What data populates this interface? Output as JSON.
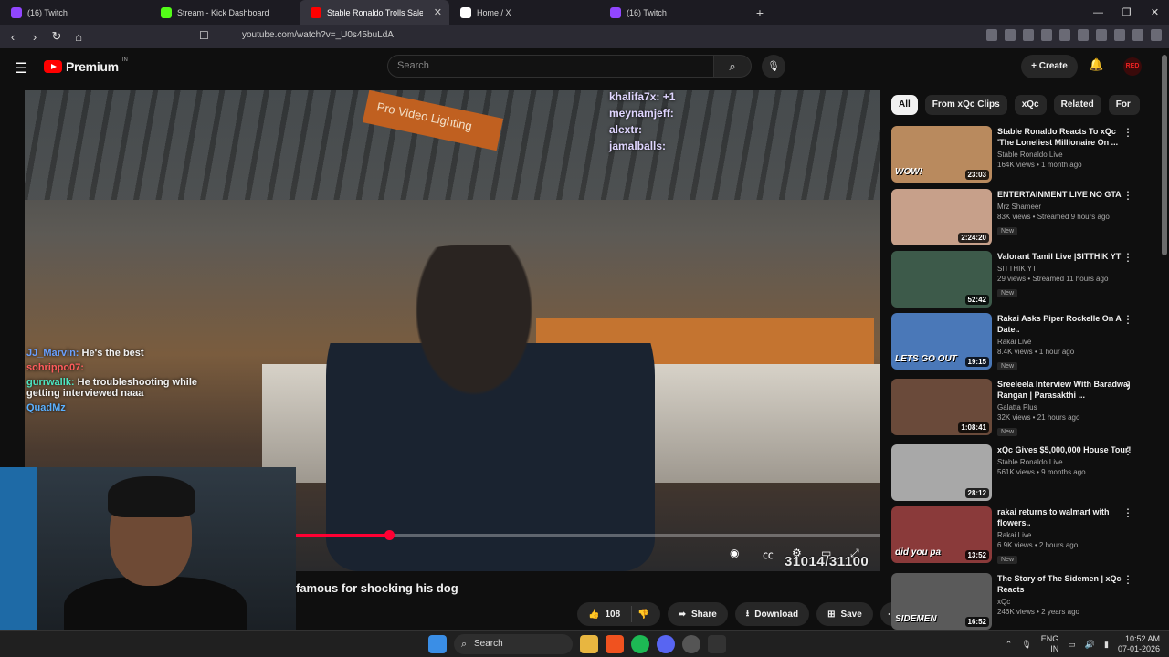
{
  "tabs": [
    {
      "label": "(16) Twitch",
      "color": "#9146ff"
    },
    {
      "label": "Stream - Kick Dashboard",
      "color": "#53fc18"
    },
    {
      "label": "Stable Ronaldo Trolls Salesma",
      "color": "#ff0000"
    },
    {
      "label": "Home / X",
      "color": "#ffffff"
    },
    {
      "label": "(16) Twitch",
      "color": "#9146ff"
    }
  ],
  "browser": {
    "url": "youtube.com/watch?v=_U0s45buLdA",
    "new_tab": "+"
  },
  "header": {
    "brand": "Premium",
    "region": "IN",
    "search_placeholder": "Search",
    "create_label": "Create",
    "avatar_text": "RED"
  },
  "player": {
    "banner_text": "Pro Video Lighting",
    "chat_top": [
      "khalifa7x: +1",
      "meynamjeff:",
      "alextr:",
      "jamalballs:"
    ],
    "overlay_chat": [
      {
        "user": "JJ_Marvin:",
        "msg": "He's the best"
      },
      {
        "user": "sohrippo07:",
        "msg": ""
      },
      {
        "user": "gurrwallk:",
        "msg": "He troubleshooting while getting interviewed naaa"
      },
      {
        "user": "QuadMz",
        "msg": ""
      }
    ],
    "counter": "31014/31100",
    "progress": 0.16
  },
  "video": {
    "title": "famous for shocking his dog",
    "likes": "108",
    "share_label": "Share",
    "download_label": "Download",
    "save_label": "Save"
  },
  "chips": [
    "All",
    "From xQc Clips",
    "xQc",
    "Related",
    "For"
  ],
  "recommendations": [
    {
      "title": "Stable Ronaldo Reacts To xQc 'The Loneliest Millionaire On ...",
      "channel": "Stable Ronaldo Live",
      "stats": "164K views • 1 month ago",
      "duration": "23:03",
      "thumb_text": "WOW!",
      "new": "",
      "color": "#b98a5e"
    },
    {
      "title": "ENTERTAINMENT LIVE NO GTA",
      "channel": "Mrz Shameer",
      "stats": "83K views • Streamed 9 hours ago",
      "duration": "2:24:20",
      "thumb_text": "",
      "new": "New",
      "color": "#c7a08a"
    },
    {
      "title": "Valorant Tamil Live |SITTHIK YT",
      "channel": "SITTHIK YT",
      "stats": "29 views • Streamed 11 hours ago",
      "duration": "52:42",
      "thumb_text": "",
      "new": "New",
      "color": "#3d5a4a"
    },
    {
      "title": "Rakai Asks Piper Rockelle On A Date..",
      "channel": "Rakai Live",
      "stats": "8.4K views • 1 hour ago",
      "duration": "19:15",
      "thumb_text": "LETS GO OUT",
      "new": "New",
      "color": "#4a78b8"
    },
    {
      "title": "Sreeleela Interview With Baradwaj Rangan | Parasakthi ...",
      "channel": "Galatta Plus",
      "stats": "32K views • 21 hours ago",
      "duration": "1:08:41",
      "thumb_text": "",
      "new": "New",
      "color": "#6a4a3a"
    },
    {
      "title": "xQc Gives $5,000,000 House Tour!",
      "channel": "Stable Ronaldo Live",
      "stats": "561K views • 9 months ago",
      "duration": "28:12",
      "thumb_text": "",
      "new": "",
      "color": "#a8a8a8"
    },
    {
      "title": "rakai returns to walmart with flowers..",
      "channel": "Rakai Live",
      "stats": "6.9K views • 2 hours ago",
      "duration": "13:52",
      "thumb_text": "did you pa",
      "new": "New",
      "color": "#8a3a3a"
    },
    {
      "title": "The Story of The Sidemen | xQc Reacts",
      "channel": "xQc",
      "stats": "246K views • 2 years ago",
      "duration": "16:52",
      "thumb_text": "SIDEMEN",
      "new": "",
      "color": "#5a5a5a"
    }
  ],
  "taskbar": {
    "search_label": "Search",
    "lang": "ENG",
    "region": "IN",
    "time": "10:52 AM",
    "date": "07-01-2026"
  }
}
